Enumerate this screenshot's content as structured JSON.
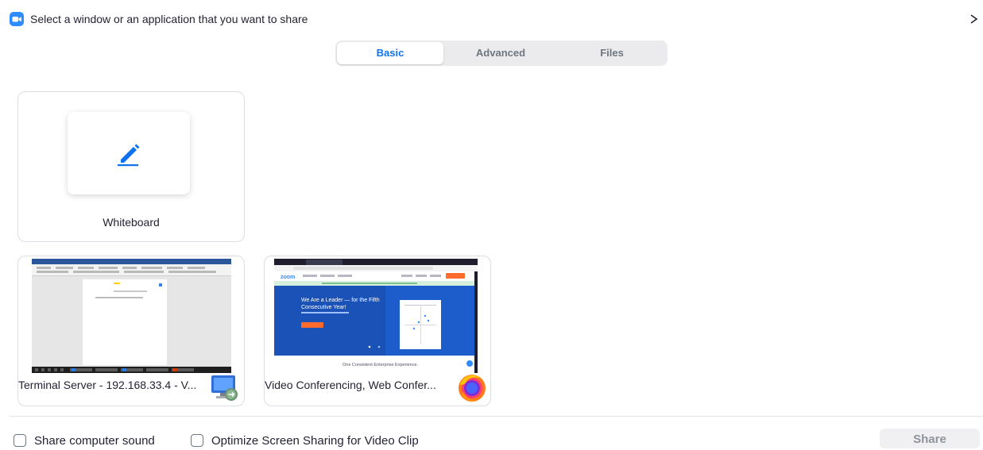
{
  "window": {
    "title": "Select a window or an application that you want to share",
    "app_icon": "zoom-camera-icon",
    "close_icon": "close-icon"
  },
  "tabs": [
    {
      "label": "Basic",
      "active": true
    },
    {
      "label": "Advanced",
      "active": false
    },
    {
      "label": "Files",
      "active": false
    }
  ],
  "sources": {
    "whiteboard": {
      "label": "Whiteboard",
      "icon": "pen-icon"
    },
    "terminal": {
      "label": "Terminal Server - 192.168.33.4 - V...",
      "icon": "remote-desktop-icon"
    },
    "browser": {
      "label": "Video Conferencing, Web Confer...",
      "icon": "firefox-icon",
      "preview": {
        "headline_line1": "We Are a Leader — for the Fifth",
        "headline_line2": "Consecutive Year!",
        "footer": "One Consistent Enterprise Experience."
      }
    }
  },
  "footer": {
    "share_sound_label": "Share computer sound",
    "share_sound_checked": false,
    "optimize_label": "Optimize Screen Sharing for Video Clip",
    "optimize_checked": false,
    "share_button": "Share"
  },
  "colors": {
    "accent": "#0e72ed",
    "zoom_blue": "#2d8cff",
    "tab_bg": "#ebebee",
    "border": "#dcdce2"
  }
}
